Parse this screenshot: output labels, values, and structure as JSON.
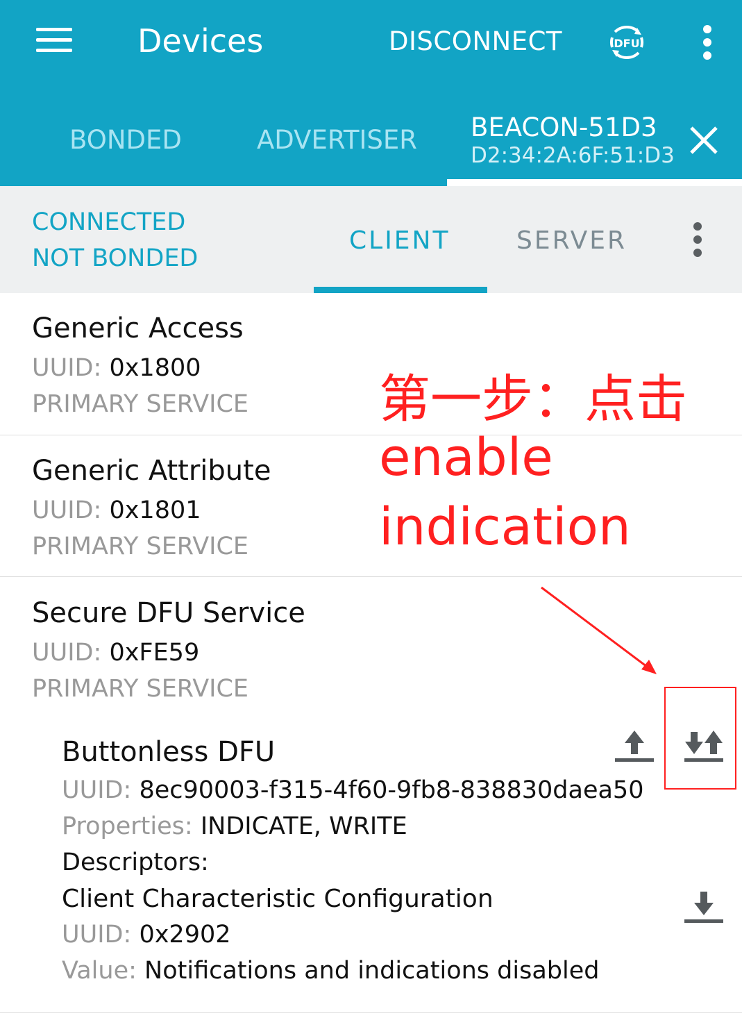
{
  "appbar": {
    "title": "Devices",
    "disconnect_label": "DISCONNECT",
    "dfu_icon_text": "DFU",
    "tabs": [
      "BONDED",
      "ADVERTISER"
    ],
    "active_device": {
      "name": "BEACON-51D3",
      "address": "D2:34:2A:6F:51:D3"
    }
  },
  "subbar": {
    "status_line1": "CONNECTED",
    "status_line2": "NOT BONDED",
    "tabs": [
      "CLIENT",
      "SERVER"
    ],
    "active_tab": "CLIENT"
  },
  "labels": {
    "uuid": "UUID:",
    "properties": "Properties:",
    "descriptors": "Descriptors:",
    "value": "Value:"
  },
  "services": [
    {
      "name": "Generic Access",
      "uuid": "0x1800",
      "type": "PRIMARY SERVICE"
    },
    {
      "name": "Generic Attribute",
      "uuid": "0x1801",
      "type": "PRIMARY SERVICE"
    },
    {
      "name": "Secure DFU Service",
      "uuid": "0xFE59",
      "type": "PRIMARY SERVICE"
    }
  ],
  "characteristic": {
    "name": "Buttonless DFU",
    "uuid": "8ec90003-f315-4f60-9fb8-838830daea50",
    "properties": "INDICATE, WRITE",
    "descriptor": {
      "name": "Client Characteristic Configuration",
      "uuid": "0x2902",
      "value": "Notifications and indications disabled"
    }
  },
  "annotation": {
    "step_text": "第一步：点击",
    "line2": "enable",
    "line3": "indication",
    "color": "#ff2020"
  },
  "colors": {
    "primary": "#12a4c5",
    "subbar_bg": "#eef0f1"
  }
}
